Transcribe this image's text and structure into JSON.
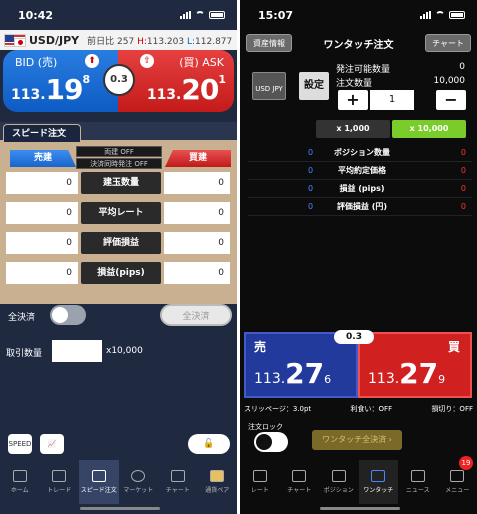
{
  "left": {
    "status": {
      "time": "10:42"
    },
    "header": {
      "pair": "USD/JPY",
      "change_label": "前日比",
      "change": "257",
      "high_label": "H:",
      "high": "113.203",
      "low_label": "L:",
      "low": "112.877"
    },
    "bid": {
      "label": "BID (売)",
      "price_small": "113.",
      "price_big": "19",
      "price_tiny": "8"
    },
    "ask": {
      "label": "(買) ASK",
      "price_small": "113.",
      "price_big": "20",
      "price_tiny": "1"
    },
    "spread": "0.3",
    "tab_label": "スピード注文",
    "sell_label": "売建",
    "buy_label": "買建",
    "flags": {
      "two_way": "両建 OFF",
      "settle_simul": "決済同時発注 OFF"
    },
    "rows": [
      {
        "label": "建玉数量",
        "left": "0",
        "right": "0"
      },
      {
        "label": "平均レート",
        "left": "0",
        "right": "0"
      },
      {
        "label": "評価損益",
        "left": "0",
        "right": "0"
      },
      {
        "label": "損益(pips)",
        "left": "0",
        "right": "0"
      }
    ],
    "settle_all_label": "全決済",
    "settle_all_button": "全決済",
    "qty_label": "取引数量",
    "qty_unit": "x10,000",
    "icons": {
      "speed": "SPEED",
      "chart": "chart"
    },
    "tabs": [
      "ホーム",
      "トレード",
      "スピード注文",
      "マーケット",
      "チャート",
      "通貨ペア"
    ]
  },
  "right": {
    "status": {
      "time": "15:07"
    },
    "header": {
      "left_btn": "資産情報",
      "title": "ワンタッチ注文",
      "right_btn": "チャート"
    },
    "pair_short": "USD JPY",
    "settings": "設定",
    "available_label": "発注可能数量",
    "available": "0",
    "order_qty_label": "注文数量",
    "order_qty": "10,000",
    "qty_input": "1",
    "plus": "+",
    "minus": "−",
    "mult_a": "x 1,000",
    "mult_b": "x 10,000",
    "positions": [
      {
        "label": "ポジション数量",
        "left": "0",
        "right": "0"
      },
      {
        "label": "平均約定価格",
        "left": "0",
        "right": "0"
      },
      {
        "label": "損益 (pips)",
        "left": "0",
        "right": "0"
      },
      {
        "label": "評価損益 (円)",
        "left": "0",
        "right": "0"
      }
    ],
    "sell": {
      "label": "売",
      "price_small": "113.",
      "price_big": "27",
      "price_tiny": "6"
    },
    "buy": {
      "label": "買",
      "price_small": "113.",
      "price_big": "27",
      "price_tiny": "9"
    },
    "spread": "0.3",
    "slippage": "スリッページ：3.0pt",
    "take_profit": "利食い：OFF",
    "stop_loss": "損切り：OFF",
    "lock_label": "注文ロック",
    "one_touch_all": "ワンタッチ全決済 ›",
    "tabs": [
      "レート",
      "チャート",
      "ポジション",
      "ワンタッチ",
      "ニュース",
      "メニュー"
    ],
    "badge": "19"
  }
}
